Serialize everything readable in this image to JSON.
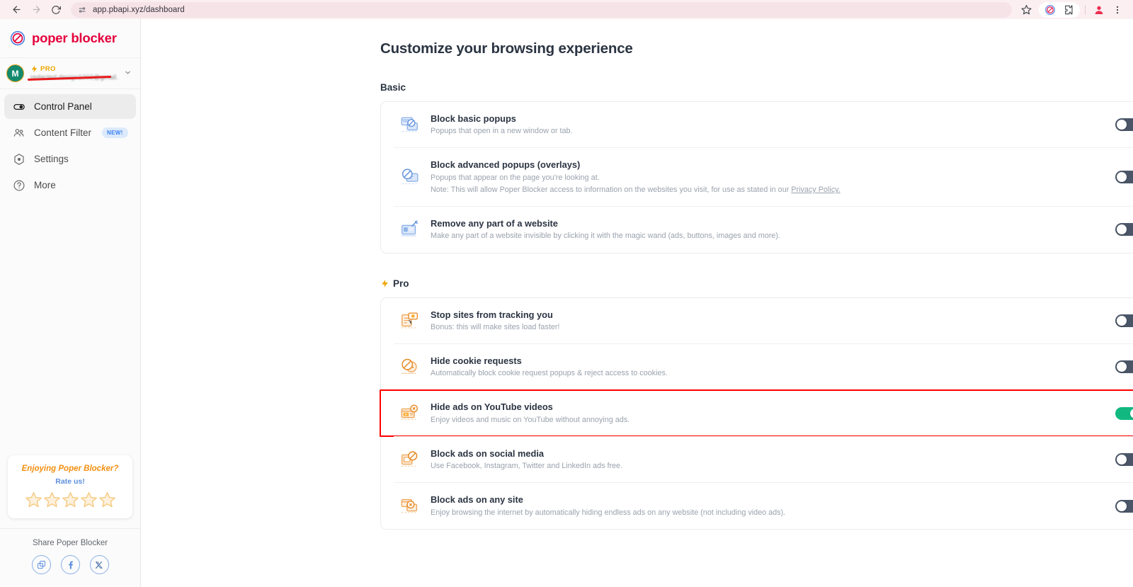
{
  "browser": {
    "back_icon": "back-arrow-icon",
    "forward_icon": "forward-arrow-icon",
    "reload_icon": "reload-icon",
    "site_settings_icon": "site-settings-icon",
    "url": "app.pbapi.xyz/dashboard",
    "bookmark_icon": "star-icon",
    "extension_poper_icon": "poper-blocker-extension-icon",
    "extensions_icon": "extensions-puzzle-icon",
    "profile_icon": "profile-avatar-icon",
    "menu_icon": "three-dot-menu-icon"
  },
  "sidebar": {
    "brand": {
      "logo_icon": "no-entry-logo-icon",
      "name": "poper blocker"
    },
    "account": {
      "avatar_initial": "M",
      "plan_icon": "lightning-bolt-icon",
      "plan_label": "PRO",
      "email": "redacted.design1002@gmail.com",
      "chevron_icon": "chevron-down-icon"
    },
    "items": [
      {
        "label": "Control Panel",
        "icon": "toggle-switch-icon",
        "active": true,
        "badge": ""
      },
      {
        "label": "Content Filter",
        "icon": "people-group-icon",
        "active": false,
        "badge": "NEW!"
      },
      {
        "label": "Settings",
        "icon": "gear-hex-icon",
        "active": false,
        "badge": ""
      },
      {
        "label": "More",
        "icon": "question-circle-icon",
        "active": false,
        "badge": ""
      }
    ],
    "rate_card": {
      "title": "Enjoying Poper Blocker?",
      "subtitle": "Rate us!",
      "stars": 5,
      "star_icon": "star-outline-icon"
    },
    "share": {
      "label": "Share Poper Blocker",
      "buttons": [
        {
          "icon": "copy-link-icon",
          "name": "copy"
        },
        {
          "icon": "facebook-icon",
          "name": "facebook"
        },
        {
          "icon": "x-twitter-icon",
          "name": "x"
        }
      ]
    }
  },
  "main": {
    "page_title": "Customize your browsing experience",
    "sections": [
      {
        "heading": "Basic",
        "heading_icon": "",
        "rows": [
          {
            "title": "Block basic popups",
            "desc": "Popups that open in a new window or tab.",
            "note": "",
            "link": "",
            "icon": "popup-window-blocked-icon",
            "toggle": "off"
          },
          {
            "title": "Block advanced popups (overlays)",
            "desc": "Popups that appear on the page you're looking at.",
            "note": "Note: This will allow Poper Blocker access to information on the websites you visit, for use as stated in our ",
            "link": "Privacy Policy.",
            "icon": "overlay-blocked-icon",
            "toggle": "off"
          },
          {
            "title": "Remove any part of a website",
            "desc": "Make any part of a website invisible by clicking it with the magic wand (ads, buttons, images and more).",
            "note": "",
            "link": "",
            "icon": "magic-wand-website-icon",
            "toggle": "off"
          }
        ]
      },
      {
        "heading": "Pro",
        "heading_icon": "lightning-bolt-icon",
        "rows": [
          {
            "title": "Stop sites from tracking you",
            "desc": "Bonus: this will make sites load faster!",
            "note": "",
            "link": "",
            "icon": "tracking-shield-icon",
            "toggle": "off"
          },
          {
            "title": "Hide cookie requests",
            "desc": "Automatically block cookie request popups & reject access to cookies.",
            "note": "",
            "link": "",
            "icon": "cookie-blocked-icon",
            "toggle": "off"
          },
          {
            "title": "Hide ads on YouTube videos",
            "desc": "Enjoy videos and music on YouTube without annoying ads.",
            "note": "",
            "link": "",
            "icon": "video-ad-blocked-icon",
            "toggle": "on",
            "highlighted": true
          },
          {
            "title": "Block ads on social media",
            "desc": "Use Facebook, Instagram, Twitter and LinkedIn ads free.",
            "note": "",
            "link": "",
            "icon": "social-ad-blocked-icon",
            "toggle": "off"
          },
          {
            "title": "Block ads on any site",
            "desc": "Enjoy browsing the internet by automatically hiding endless ads on any website (not including video ads).",
            "note": "",
            "link": "",
            "icon": "any-site-ad-blocked-icon",
            "toggle": "off"
          }
        ]
      }
    ]
  },
  "colors": {
    "brand": "#e5003c",
    "toggle_on": "#11b981",
    "toggle_off": "#4a5568",
    "pro_accent": "#f0a500",
    "highlight": "#ff0000",
    "badge_new": "#3b82f6"
  }
}
